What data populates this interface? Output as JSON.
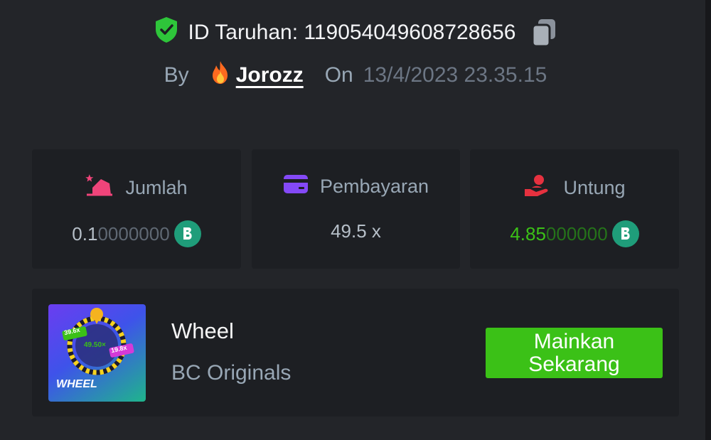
{
  "bet": {
    "id_label": "ID Taruhan: 119054049608728656",
    "by_label": "By",
    "username": "Jorozz",
    "on_label": "On",
    "date": "13/4/2023 23.35.15"
  },
  "stats": [
    {
      "label": "Jumlah",
      "value_bright": "0.1",
      "value_dim": "0000000",
      "icon": "bet-amount-icon",
      "color": "#f0447a"
    },
    {
      "label": "Pembayaran",
      "value": "49.5 x",
      "icon": "card-icon",
      "color": "#8449f7"
    },
    {
      "label": "Untung",
      "value_bright": "4.85",
      "value_dim": "000000",
      "icon": "profit-hand-icon",
      "color": "#e6313f"
    }
  ],
  "game": {
    "title": "Wheel",
    "provider": "BC Originals",
    "thumb_text": "WHEEL",
    "thumb_mult_main": "49.50×",
    "thumb_mult_left": "39.6x",
    "thumb_mult_right": "19.8x",
    "play_label": "Mainkan Sekarang"
  },
  "colors": {
    "background": "#232529",
    "card": "#1d1f23",
    "accent_green": "#3bc117",
    "profit_green": "#3bc117",
    "shield_green": "#2ec53a",
    "coin": "#1f9d7a"
  }
}
